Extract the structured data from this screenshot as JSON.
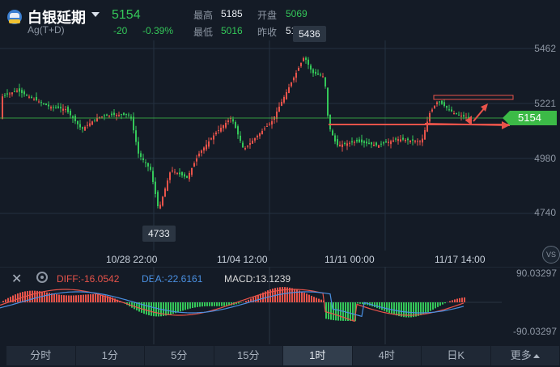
{
  "header": {
    "title": "白银延期",
    "subtitle": "Ag(T+D)",
    "price": "5154",
    "change": "-20",
    "change_pct": "-0.39%",
    "stats": {
      "high_label": "最高",
      "high": "5185",
      "open_label": "开盘",
      "open": "5069",
      "low_label": "最低",
      "low": "5016",
      "prev_close_label": "昨收",
      "prev_close": "5185"
    }
  },
  "chart": {
    "y_ticks": [
      "5462",
      "5221",
      "4980",
      "4740"
    ],
    "x_ticks": [
      "10/28 22:00",
      "11/04 12:00",
      "11/11 00:00",
      "11/17 14:00"
    ],
    "high_callout": "5436",
    "low_callout": "4733",
    "current_price": "5154",
    "vs_button": "VS"
  },
  "macd": {
    "diff": "DIFF:-16.0542",
    "dea": "DEA:-22.6161",
    "macd": "MACD:13.1239",
    "top": "90.03297",
    "bottom": "-90.03297"
  },
  "tabs": [
    "分时",
    "1分",
    "5分",
    "15分",
    "1时",
    "4时",
    "日K",
    "更多"
  ],
  "active_tab": "1时",
  "colors": {
    "up": "#e8534a",
    "down": "#34c759",
    "bg": "#141b26"
  }
}
